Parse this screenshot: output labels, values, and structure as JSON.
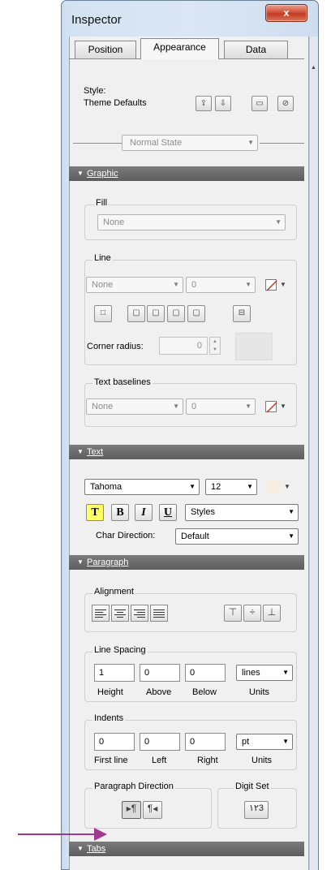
{
  "window": {
    "title": "Inspector",
    "close": "x"
  },
  "tabs": [
    "Position",
    "Appearance",
    "Data"
  ],
  "style": {
    "label": "Style:",
    "value": "Theme Defaults"
  },
  "state": {
    "label": "Normal State"
  },
  "sections": {
    "graphic": "Graphic",
    "text": "Text",
    "paragraph": "Paragraph",
    "tabs": "Tabs"
  },
  "graphic": {
    "fill": {
      "label": "Fill",
      "value": "None"
    },
    "line": {
      "label": "Line",
      "value": "None",
      "width": "0",
      "corner_radius_label": "Corner radius:",
      "corner_radius_value": "0"
    },
    "baselines": {
      "label": "Text baselines",
      "value": "None",
      "width": "0"
    }
  },
  "text": {
    "font": "Tahoma",
    "size": "12",
    "bold": "B",
    "italic": "I",
    "underline": "U",
    "highlight": "T",
    "styles": "Styles",
    "char_direction_label": "Char Direction:",
    "char_direction_value": "Default"
  },
  "paragraph": {
    "alignment_label": "Alignment",
    "line_spacing": {
      "label": "Line Spacing",
      "height": "1",
      "above": "0",
      "below": "0",
      "units": "lines",
      "height_label": "Height",
      "above_label": "Above",
      "below_label": "Below",
      "units_label": "Units"
    },
    "indents": {
      "label": "Indents",
      "first": "0",
      "left": "0",
      "right": "0",
      "units": "pt",
      "first_label": "First line",
      "left_label": "Left",
      "right_label": "Right",
      "units_label": "Units"
    },
    "direction_label": "Paragraph Direction",
    "digit_label": "Digit Set",
    "digit_value": "١٢3"
  },
  "colors": {
    "section_bg": "#6e6e6e",
    "arrow": "#a0398e",
    "none_color_stroke": "#c0392b"
  }
}
